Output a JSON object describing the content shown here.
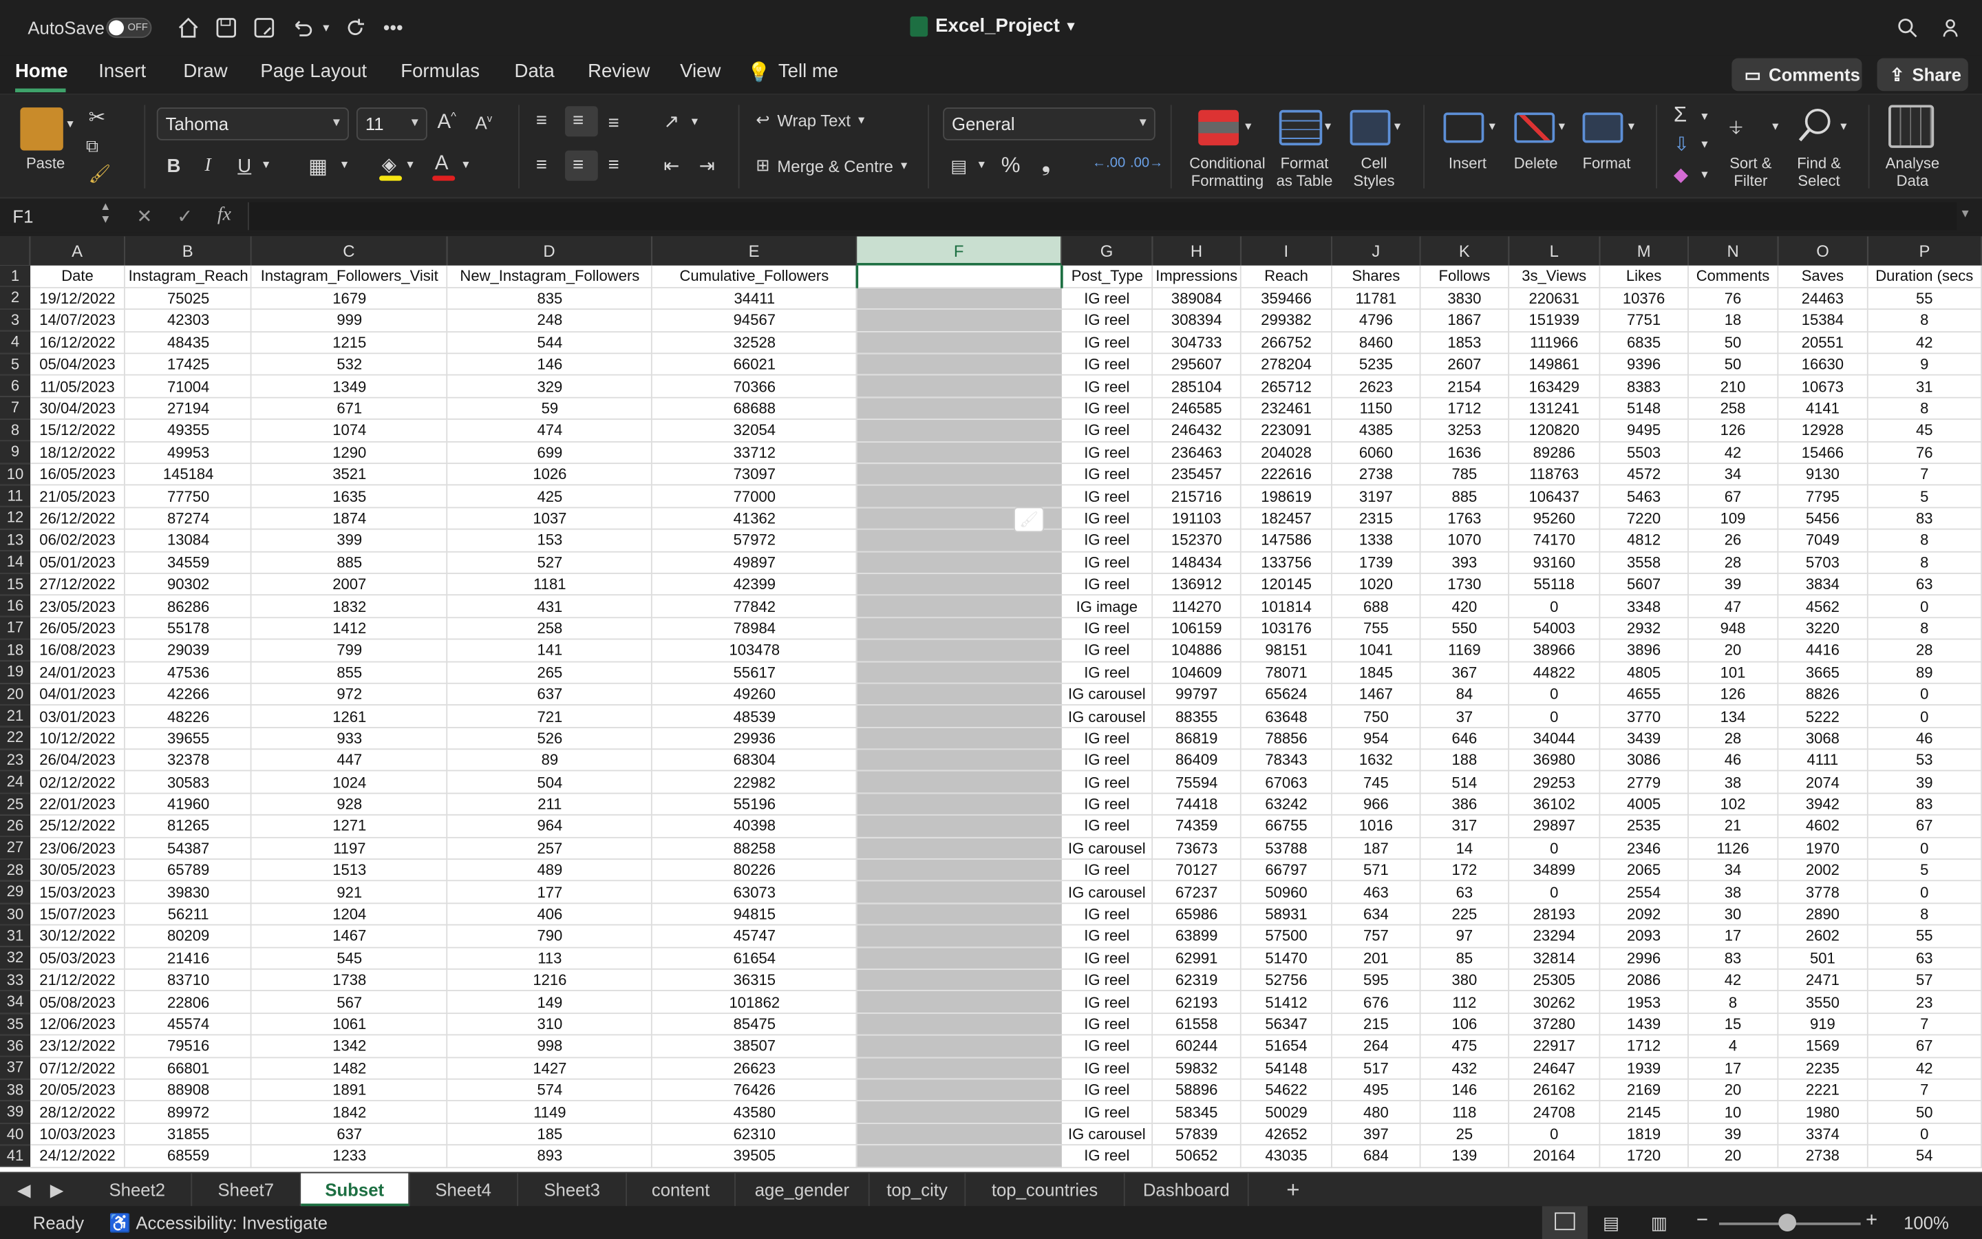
{
  "titlebar": {
    "autosave_label": "AutoSave",
    "autosave_state": "OFF",
    "doc_title": "Excel_Project"
  },
  "menu": {
    "tabs": [
      "Home",
      "Insert",
      "Draw",
      "Page Layout",
      "Formulas",
      "Data",
      "Review",
      "View"
    ],
    "tell_me": "Tell me",
    "comments": "Comments",
    "share": "Share"
  },
  "ribbon": {
    "paste": "Paste",
    "font_name": "Tahoma",
    "font_size": "11",
    "bold": "B",
    "italic": "I",
    "underline": "U",
    "wrap_text": "Wrap Text",
    "merge_centre": "Merge & Centre",
    "number_format": "General",
    "conditional_formatting": "Conditional\nFormatting",
    "format_as_table": "Format\nas Table",
    "cell_styles": "Cell\nStyles",
    "insert": "Insert",
    "delete": "Delete",
    "format": "Format",
    "sort_filter": "Sort &\nFilter",
    "find_select": "Find &\nSelect",
    "analyse_data": "Analyse\nData"
  },
  "formula_bar": {
    "name_box": "F1",
    "fx": "fx",
    "value": ""
  },
  "columns": [
    "A",
    "B",
    "C",
    "D",
    "E",
    "F",
    "G",
    "H",
    "I",
    "J",
    "K",
    "L",
    "M",
    "N",
    "O",
    "P"
  ],
  "selected_column": "F",
  "rows": [
    [
      "Date",
      "Instagram_Reach",
      "Instagram_Followers_Visit",
      "New_Instagram_Followers",
      "Cumulative_Followers",
      "",
      "Post_Type",
      "Impressions",
      "Reach",
      "Shares",
      "Follows",
      "3s_Views",
      "Likes",
      "Comments",
      "Saves",
      "Duration (secs"
    ],
    [
      "19/12/2022",
      "75025",
      "1679",
      "835",
      "34411",
      "",
      "IG reel",
      "389084",
      "359466",
      "11781",
      "3830",
      "220631",
      "10376",
      "76",
      "24463",
      "55"
    ],
    [
      "14/07/2023",
      "42303",
      "999",
      "248",
      "94567",
      "",
      "IG reel",
      "308394",
      "299382",
      "4796",
      "1867",
      "151939",
      "7751",
      "18",
      "15384",
      "8"
    ],
    [
      "16/12/2022",
      "48435",
      "1215",
      "544",
      "32528",
      "",
      "IG reel",
      "304733",
      "266752",
      "8460",
      "1853",
      "111966",
      "6835",
      "50",
      "20551",
      "42"
    ],
    [
      "05/04/2023",
      "17425",
      "532",
      "146",
      "66021",
      "",
      "IG reel",
      "295607",
      "278204",
      "5235",
      "2607",
      "149861",
      "9396",
      "50",
      "16630",
      "9"
    ],
    [
      "11/05/2023",
      "71004",
      "1349",
      "329",
      "70366",
      "",
      "IG reel",
      "285104",
      "265712",
      "2623",
      "2154",
      "163429",
      "8383",
      "210",
      "10673",
      "31"
    ],
    [
      "30/04/2023",
      "27194",
      "671",
      "59",
      "68688",
      "",
      "IG reel",
      "246585",
      "232461",
      "1150",
      "1712",
      "131241",
      "5148",
      "258",
      "4141",
      "8"
    ],
    [
      "15/12/2022",
      "49355",
      "1074",
      "474",
      "32054",
      "",
      "IG reel",
      "246432",
      "223091",
      "4385",
      "3253",
      "120820",
      "9495",
      "126",
      "12928",
      "45"
    ],
    [
      "18/12/2022",
      "49953",
      "1290",
      "699",
      "33712",
      "",
      "IG reel",
      "236463",
      "204028",
      "6060",
      "1636",
      "89286",
      "5503",
      "42",
      "15466",
      "76"
    ],
    [
      "16/05/2023",
      "145184",
      "3521",
      "1026",
      "73097",
      "",
      "IG reel",
      "235457",
      "222616",
      "2738",
      "785",
      "118763",
      "4572",
      "34",
      "9130",
      "7"
    ],
    [
      "21/05/2023",
      "77750",
      "1635",
      "425",
      "77000",
      "",
      "IG reel",
      "215716",
      "198619",
      "3197",
      "885",
      "106437",
      "5463",
      "67",
      "7795",
      "5"
    ],
    [
      "26/12/2022",
      "87274",
      "1874",
      "1037",
      "41362",
      "",
      "IG reel",
      "191103",
      "182457",
      "2315",
      "1763",
      "95260",
      "7220",
      "109",
      "5456",
      "83"
    ],
    [
      "06/02/2023",
      "13084",
      "399",
      "153",
      "57972",
      "",
      "IG reel",
      "152370",
      "147586",
      "1338",
      "1070",
      "74170",
      "4812",
      "26",
      "7049",
      "8"
    ],
    [
      "05/01/2023",
      "34559",
      "885",
      "527",
      "49897",
      "",
      "IG reel",
      "148434",
      "133756",
      "1739",
      "393",
      "93160",
      "3558",
      "28",
      "5703",
      "8"
    ],
    [
      "27/12/2022",
      "90302",
      "2007",
      "1181",
      "42399",
      "",
      "IG reel",
      "136912",
      "120145",
      "1020",
      "1730",
      "55118",
      "5607",
      "39",
      "3834",
      "63"
    ],
    [
      "23/05/2023",
      "86286",
      "1832",
      "431",
      "77842",
      "",
      "IG image",
      "114270",
      "101814",
      "688",
      "420",
      "0",
      "3348",
      "47",
      "4562",
      "0"
    ],
    [
      "26/05/2023",
      "55178",
      "1412",
      "258",
      "78984",
      "",
      "IG reel",
      "106159",
      "103176",
      "755",
      "550",
      "54003",
      "2932",
      "948",
      "3220",
      "8"
    ],
    [
      "16/08/2023",
      "29039",
      "799",
      "141",
      "103478",
      "",
      "IG reel",
      "104886",
      "98151",
      "1041",
      "1169",
      "38966",
      "3896",
      "20",
      "4416",
      "28"
    ],
    [
      "24/01/2023",
      "47536",
      "855",
      "265",
      "55617",
      "",
      "IG reel",
      "104609",
      "78071",
      "1845",
      "367",
      "44822",
      "4805",
      "101",
      "3665",
      "89"
    ],
    [
      "04/01/2023",
      "42266",
      "972",
      "637",
      "49260",
      "",
      "IG carousel",
      "99797",
      "65624",
      "1467",
      "84",
      "0",
      "4655",
      "126",
      "8826",
      "0"
    ],
    [
      "03/01/2023",
      "48226",
      "1261",
      "721",
      "48539",
      "",
      "IG carousel",
      "88355",
      "63648",
      "750",
      "37",
      "0",
      "3770",
      "134",
      "5222",
      "0"
    ],
    [
      "10/12/2022",
      "39655",
      "933",
      "526",
      "29936",
      "",
      "IG reel",
      "86819",
      "78856",
      "954",
      "646",
      "34044",
      "3439",
      "28",
      "3068",
      "46"
    ],
    [
      "26/04/2023",
      "32378",
      "447",
      "89",
      "68304",
      "",
      "IG reel",
      "86409",
      "78343",
      "1632",
      "188",
      "36980",
      "3086",
      "46",
      "4111",
      "53"
    ],
    [
      "02/12/2022",
      "30583",
      "1024",
      "504",
      "22982",
      "",
      "IG reel",
      "75594",
      "67063",
      "745",
      "514",
      "29253",
      "2779",
      "38",
      "2074",
      "39"
    ],
    [
      "22/01/2023",
      "41960",
      "928",
      "211",
      "55196",
      "",
      "IG reel",
      "74418",
      "63242",
      "966",
      "386",
      "36102",
      "4005",
      "102",
      "3942",
      "83"
    ],
    [
      "25/12/2022",
      "81265",
      "1271",
      "964",
      "40398",
      "",
      "IG reel",
      "74359",
      "66755",
      "1016",
      "317",
      "29897",
      "2535",
      "21",
      "4602",
      "67"
    ],
    [
      "23/06/2023",
      "54387",
      "1197",
      "257",
      "88258",
      "",
      "IG carousel",
      "73673",
      "53788",
      "187",
      "14",
      "0",
      "2346",
      "1126",
      "1970",
      "0"
    ],
    [
      "30/05/2023",
      "65789",
      "1513",
      "489",
      "80226",
      "",
      "IG reel",
      "70127",
      "66797",
      "571",
      "172",
      "34899",
      "2065",
      "34",
      "2002",
      "5"
    ],
    [
      "15/03/2023",
      "39830",
      "921",
      "177",
      "63073",
      "",
      "IG carousel",
      "67237",
      "50960",
      "463",
      "63",
      "0",
      "2554",
      "38",
      "3778",
      "0"
    ],
    [
      "15/07/2023",
      "56211",
      "1204",
      "406",
      "94815",
      "",
      "IG reel",
      "65986",
      "58931",
      "634",
      "225",
      "28193",
      "2092",
      "30",
      "2890",
      "8"
    ],
    [
      "30/12/2022",
      "80209",
      "1467",
      "790",
      "45747",
      "",
      "IG reel",
      "63899",
      "57500",
      "757",
      "97",
      "23294",
      "2093",
      "17",
      "2602",
      "55"
    ],
    [
      "05/03/2023",
      "21416",
      "545",
      "113",
      "61654",
      "",
      "IG reel",
      "62991",
      "51470",
      "201",
      "85",
      "32814",
      "2996",
      "83",
      "501",
      "63"
    ],
    [
      "21/12/2022",
      "83710",
      "1738",
      "1216",
      "36315",
      "",
      "IG reel",
      "62319",
      "52756",
      "595",
      "380",
      "25305",
      "2086",
      "42",
      "2471",
      "57"
    ],
    [
      "05/08/2023",
      "22806",
      "567",
      "149",
      "101862",
      "",
      "IG reel",
      "62193",
      "51412",
      "676",
      "112",
      "30262",
      "1953",
      "8",
      "3550",
      "23"
    ],
    [
      "12/06/2023",
      "45574",
      "1061",
      "310",
      "85475",
      "",
      "IG reel",
      "61558",
      "56347",
      "215",
      "106",
      "37280",
      "1439",
      "15",
      "919",
      "7"
    ],
    [
      "23/12/2022",
      "79516",
      "1342",
      "998",
      "38507",
      "",
      "IG reel",
      "60244",
      "51654",
      "264",
      "475",
      "22917",
      "1712",
      "4",
      "1569",
      "67"
    ],
    [
      "07/12/2022",
      "66801",
      "1482",
      "1427",
      "26623",
      "",
      "IG reel",
      "59832",
      "54148",
      "517",
      "432",
      "24647",
      "1939",
      "17",
      "2235",
      "42"
    ],
    [
      "20/05/2023",
      "88908",
      "1891",
      "574",
      "76426",
      "",
      "IG reel",
      "58896",
      "54622",
      "495",
      "146",
      "26162",
      "2169",
      "20",
      "2221",
      "7"
    ],
    [
      "28/12/2022",
      "89972",
      "1842",
      "1149",
      "43580",
      "",
      "IG reel",
      "58345",
      "50029",
      "480",
      "118",
      "24708",
      "2145",
      "10",
      "1980",
      "50"
    ],
    [
      "10/03/2023",
      "31855",
      "637",
      "185",
      "62310",
      "",
      "IG carousel",
      "57839",
      "42652",
      "397",
      "25",
      "0",
      "1819",
      "39",
      "3374",
      "0"
    ],
    [
      "24/12/2022",
      "68559",
      "1233",
      "893",
      "39505",
      "",
      "IG reel",
      "50652",
      "43035",
      "684",
      "139",
      "20164",
      "1720",
      "20",
      "2738",
      "54"
    ]
  ],
  "sheets": [
    "Sheet2",
    "Sheet7",
    "Subset",
    "Sheet4",
    "Sheet3",
    "content",
    "age_gender",
    "top_city",
    "top_countries",
    "Dashboard"
  ],
  "active_sheet": "Subset",
  "status": {
    "ready": "Ready",
    "accessibility": "Accessibility: Investigate",
    "zoom": "100%"
  }
}
